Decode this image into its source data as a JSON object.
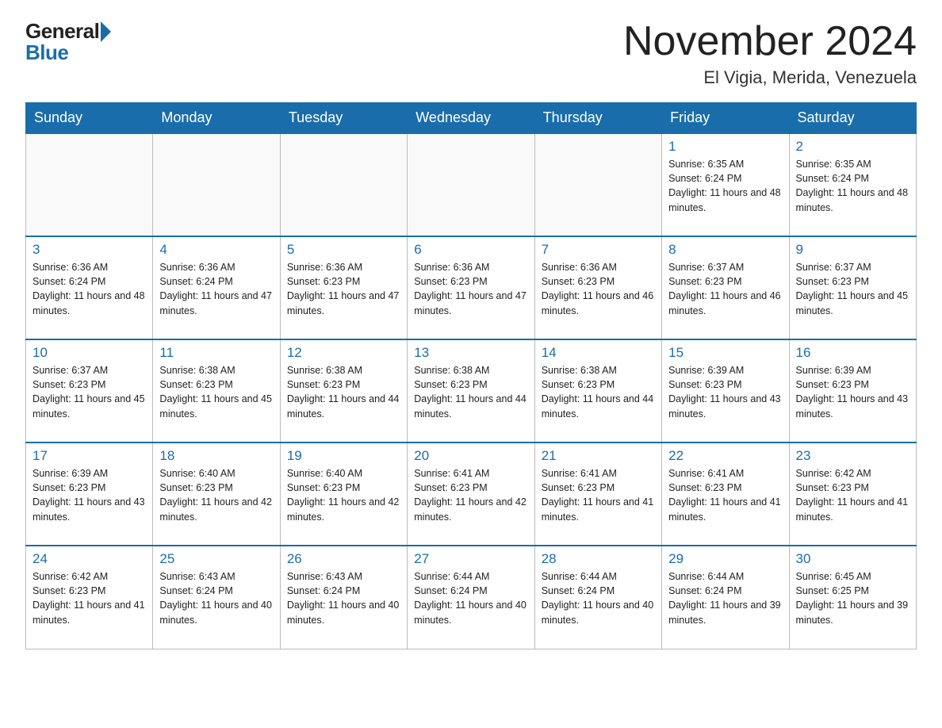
{
  "logo": {
    "general": "General",
    "blue": "Blue"
  },
  "title": "November 2024",
  "subtitle": "El Vigia, Merida, Venezuela",
  "days_of_week": [
    "Sunday",
    "Monday",
    "Tuesday",
    "Wednesday",
    "Thursday",
    "Friday",
    "Saturday"
  ],
  "weeks": [
    [
      {
        "day": "",
        "info": ""
      },
      {
        "day": "",
        "info": ""
      },
      {
        "day": "",
        "info": ""
      },
      {
        "day": "",
        "info": ""
      },
      {
        "day": "",
        "info": ""
      },
      {
        "day": "1",
        "info": "Sunrise: 6:35 AM\nSunset: 6:24 PM\nDaylight: 11 hours and 48 minutes."
      },
      {
        "day": "2",
        "info": "Sunrise: 6:35 AM\nSunset: 6:24 PM\nDaylight: 11 hours and 48 minutes."
      }
    ],
    [
      {
        "day": "3",
        "info": "Sunrise: 6:36 AM\nSunset: 6:24 PM\nDaylight: 11 hours and 48 minutes."
      },
      {
        "day": "4",
        "info": "Sunrise: 6:36 AM\nSunset: 6:24 PM\nDaylight: 11 hours and 47 minutes."
      },
      {
        "day": "5",
        "info": "Sunrise: 6:36 AM\nSunset: 6:23 PM\nDaylight: 11 hours and 47 minutes."
      },
      {
        "day": "6",
        "info": "Sunrise: 6:36 AM\nSunset: 6:23 PM\nDaylight: 11 hours and 47 minutes."
      },
      {
        "day": "7",
        "info": "Sunrise: 6:36 AM\nSunset: 6:23 PM\nDaylight: 11 hours and 46 minutes."
      },
      {
        "day": "8",
        "info": "Sunrise: 6:37 AM\nSunset: 6:23 PM\nDaylight: 11 hours and 46 minutes."
      },
      {
        "day": "9",
        "info": "Sunrise: 6:37 AM\nSunset: 6:23 PM\nDaylight: 11 hours and 45 minutes."
      }
    ],
    [
      {
        "day": "10",
        "info": "Sunrise: 6:37 AM\nSunset: 6:23 PM\nDaylight: 11 hours and 45 minutes."
      },
      {
        "day": "11",
        "info": "Sunrise: 6:38 AM\nSunset: 6:23 PM\nDaylight: 11 hours and 45 minutes."
      },
      {
        "day": "12",
        "info": "Sunrise: 6:38 AM\nSunset: 6:23 PM\nDaylight: 11 hours and 44 minutes."
      },
      {
        "day": "13",
        "info": "Sunrise: 6:38 AM\nSunset: 6:23 PM\nDaylight: 11 hours and 44 minutes."
      },
      {
        "day": "14",
        "info": "Sunrise: 6:38 AM\nSunset: 6:23 PM\nDaylight: 11 hours and 44 minutes."
      },
      {
        "day": "15",
        "info": "Sunrise: 6:39 AM\nSunset: 6:23 PM\nDaylight: 11 hours and 43 minutes."
      },
      {
        "day": "16",
        "info": "Sunrise: 6:39 AM\nSunset: 6:23 PM\nDaylight: 11 hours and 43 minutes."
      }
    ],
    [
      {
        "day": "17",
        "info": "Sunrise: 6:39 AM\nSunset: 6:23 PM\nDaylight: 11 hours and 43 minutes."
      },
      {
        "day": "18",
        "info": "Sunrise: 6:40 AM\nSunset: 6:23 PM\nDaylight: 11 hours and 42 minutes."
      },
      {
        "day": "19",
        "info": "Sunrise: 6:40 AM\nSunset: 6:23 PM\nDaylight: 11 hours and 42 minutes."
      },
      {
        "day": "20",
        "info": "Sunrise: 6:41 AM\nSunset: 6:23 PM\nDaylight: 11 hours and 42 minutes."
      },
      {
        "day": "21",
        "info": "Sunrise: 6:41 AM\nSunset: 6:23 PM\nDaylight: 11 hours and 41 minutes."
      },
      {
        "day": "22",
        "info": "Sunrise: 6:41 AM\nSunset: 6:23 PM\nDaylight: 11 hours and 41 minutes."
      },
      {
        "day": "23",
        "info": "Sunrise: 6:42 AM\nSunset: 6:23 PM\nDaylight: 11 hours and 41 minutes."
      }
    ],
    [
      {
        "day": "24",
        "info": "Sunrise: 6:42 AM\nSunset: 6:23 PM\nDaylight: 11 hours and 41 minutes."
      },
      {
        "day": "25",
        "info": "Sunrise: 6:43 AM\nSunset: 6:24 PM\nDaylight: 11 hours and 40 minutes."
      },
      {
        "day": "26",
        "info": "Sunrise: 6:43 AM\nSunset: 6:24 PM\nDaylight: 11 hours and 40 minutes."
      },
      {
        "day": "27",
        "info": "Sunrise: 6:44 AM\nSunset: 6:24 PM\nDaylight: 11 hours and 40 minutes."
      },
      {
        "day": "28",
        "info": "Sunrise: 6:44 AM\nSunset: 6:24 PM\nDaylight: 11 hours and 40 minutes."
      },
      {
        "day": "29",
        "info": "Sunrise: 6:44 AM\nSunset: 6:24 PM\nDaylight: 11 hours and 39 minutes."
      },
      {
        "day": "30",
        "info": "Sunrise: 6:45 AM\nSunset: 6:25 PM\nDaylight: 11 hours and 39 minutes."
      }
    ]
  ]
}
